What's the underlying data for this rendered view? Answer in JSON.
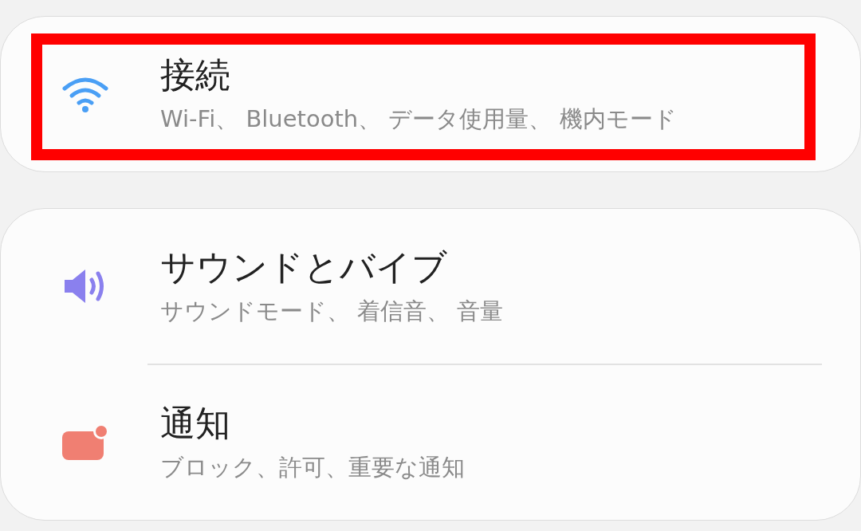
{
  "cards": [
    {
      "items": [
        {
          "kind": "wifi",
          "color": "#4a9ff5",
          "title": "接続",
          "subtitle": "Wi-Fi、 Bluetooth、 データ使用量、 機内モード",
          "highlighted": true
        }
      ]
    },
    {
      "items": [
        {
          "kind": "sound",
          "color": "#8a80ee",
          "title": "サウンドとバイブ",
          "subtitle": "サウンドモード、 着信音、 音量",
          "highlighted": false
        },
        {
          "kind": "notification",
          "color": "#f07f72",
          "title": "通知",
          "subtitle": "ブロック、許可、重要な通知",
          "highlighted": false
        }
      ]
    }
  ]
}
